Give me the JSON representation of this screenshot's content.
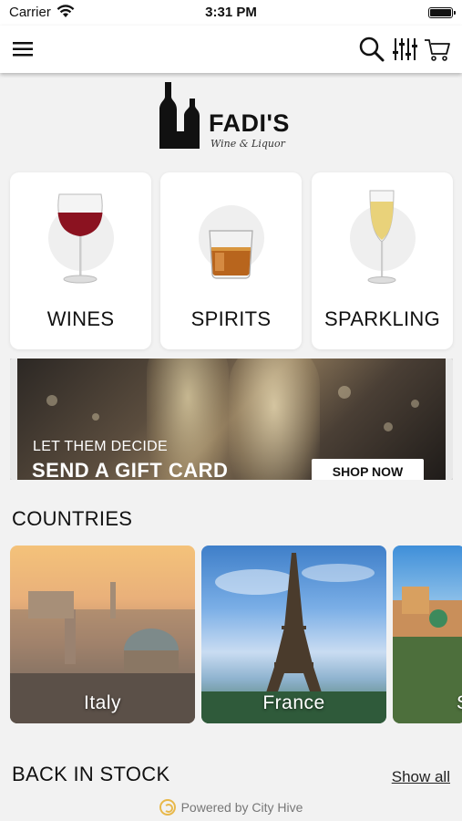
{
  "status_bar": {
    "carrier": "Carrier",
    "time": "3:31 PM"
  },
  "nav": {
    "menu_icon": "hamburger-menu-icon",
    "search_icon": "search-icon",
    "filter_icon": "filter-sliders-icon",
    "cart_icon": "shopping-cart-icon"
  },
  "logo": {
    "brand": "FADI'S",
    "tagline": "Wine & Liquor"
  },
  "categories": [
    {
      "label": "WINES",
      "icon": "red-wine-glass"
    },
    {
      "label": "SPIRITS",
      "icon": "whiskey-tumbler"
    },
    {
      "label": "SPARKLING",
      "icon": "champagne-flute"
    }
  ],
  "banner": {
    "line1": "LET THEM DECIDE",
    "line2": "SEND A GIFT CARD",
    "button": "SHOP NOW"
  },
  "countries_section": {
    "title": "COUNTRIES",
    "items": [
      {
        "label": "Italy"
      },
      {
        "label": "France"
      },
      {
        "label": "S"
      }
    ]
  },
  "back_in_stock": {
    "title": "BACK IN STOCK",
    "show_all": "Show all"
  },
  "footer": {
    "powered_by": "Powered by City Hive"
  },
  "colors": {
    "background": "#f2f2f2",
    "card": "#ffffff",
    "wine_red": "#8b1220",
    "accent_gold": "#e8b84a"
  }
}
